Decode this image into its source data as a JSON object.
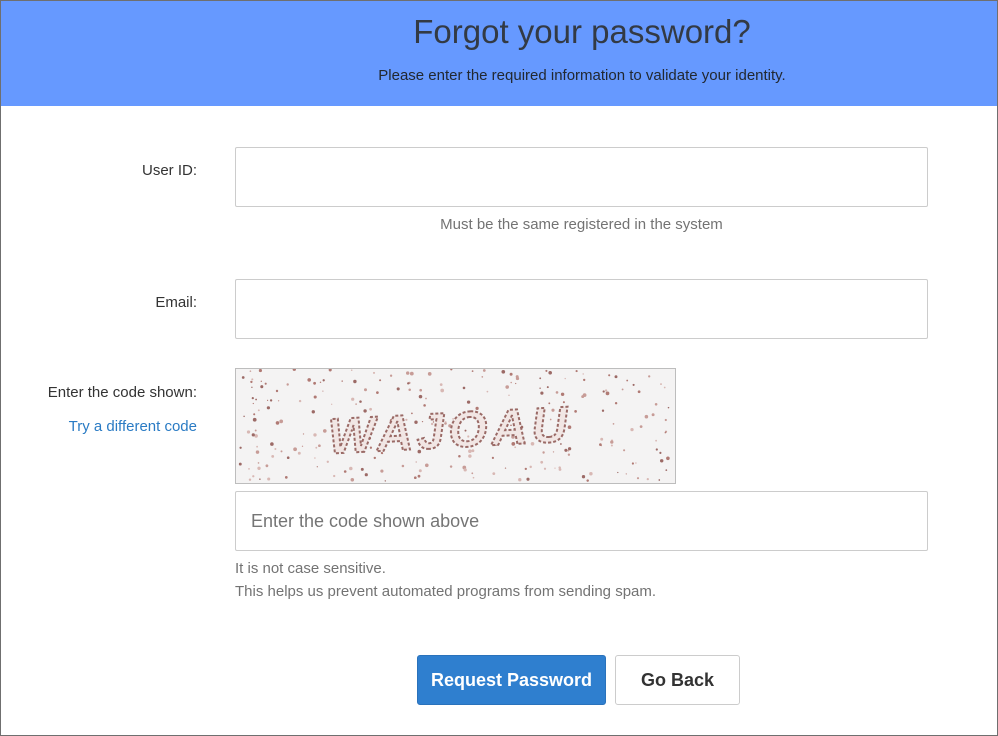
{
  "header": {
    "title": "Forgot your password?",
    "subtitle": "Please enter the required information to validate your identity."
  },
  "form": {
    "user_id": {
      "label": "User ID:",
      "value": "",
      "help": "Must be the same registered in the system"
    },
    "email": {
      "label": "Email:",
      "value": ""
    },
    "captcha": {
      "label": "Enter the code shown:",
      "link": "Try a different code",
      "code_image_text": "WAJOAU",
      "input_placeholder": "Enter the code shown above",
      "help_line1": "It is not case sensitive.",
      "help_line2": "This helps us prevent automated programs from sending spam."
    }
  },
  "buttons": {
    "request": "Request Password",
    "back": "Go Back"
  },
  "colors": {
    "header_bg": "#6699ff",
    "primary_button": "#2f7fcf",
    "link": "#2a7bc4",
    "captcha_text": "#8a5a55"
  }
}
